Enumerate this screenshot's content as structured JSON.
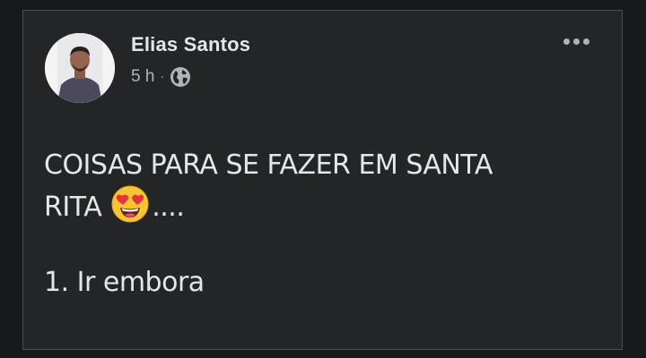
{
  "post": {
    "author": "Elias Santos",
    "time": "5 h",
    "separator": "·",
    "audience_icon": "globe-icon",
    "menu_icon": "more-options-icon",
    "text_line1": "COISAS PARA SE FAZER EM SANTA",
    "text_line2_start": "RITA",
    "text_line2_emoji": "heart-eyes-emoji",
    "text_line2_end": "....",
    "text_line3": "1. Ir embora"
  },
  "colors": {
    "card_bg": "#242526",
    "page_bg": "#18191a",
    "primary_text": "#e4e6eb",
    "secondary_text": "#b0b3b8"
  }
}
